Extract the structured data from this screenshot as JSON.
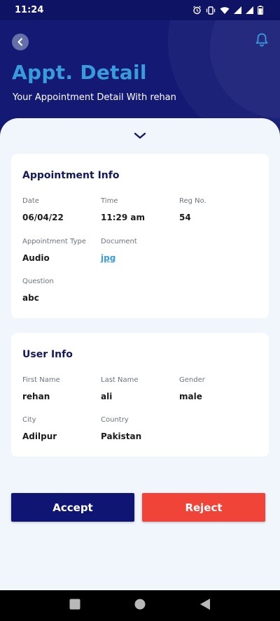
{
  "status_bar": {
    "time": "11:24",
    "icons": [
      "alarm-icon",
      "vibrate-icon",
      "wifi-icon",
      "signal-icon",
      "signal-icon",
      "battery-icon"
    ]
  },
  "header": {
    "title": "Appt. Detail",
    "subtitle": "Your Appointment Detail With rehan",
    "back_icon": "chevron-left-icon",
    "notification_icon": "bell-icon"
  },
  "appointment_info": {
    "title": "Appointment Info",
    "date_label": "Date",
    "date_value": "06/04/22",
    "time_label": "Time",
    "time_value": "11:29 am",
    "reg_label": "Reg No.",
    "reg_value": "54",
    "type_label": "Appointment Type",
    "type_value": "Audio",
    "document_label": "Document",
    "document_value": "jpg",
    "question_label": "Question",
    "question_value": "abc"
  },
  "user_info": {
    "title": "User Info",
    "first_name_label": "First Name",
    "first_name_value": "rehan",
    "last_name_label": "Last Name",
    "last_name_value": "ali",
    "gender_label": "Gender",
    "gender_value": "male",
    "city_label": "City",
    "city_value": "Adilpur",
    "country_label": "Country",
    "country_value": "Pakistan"
  },
  "actions": {
    "accept_label": "Accept",
    "reject_label": "Reject"
  },
  "colors": {
    "header_bg": "#141a74",
    "title": "#3a9bdc",
    "accept": "#0f1572",
    "reject": "#f04438",
    "panel_bg": "#f1f6fd"
  }
}
